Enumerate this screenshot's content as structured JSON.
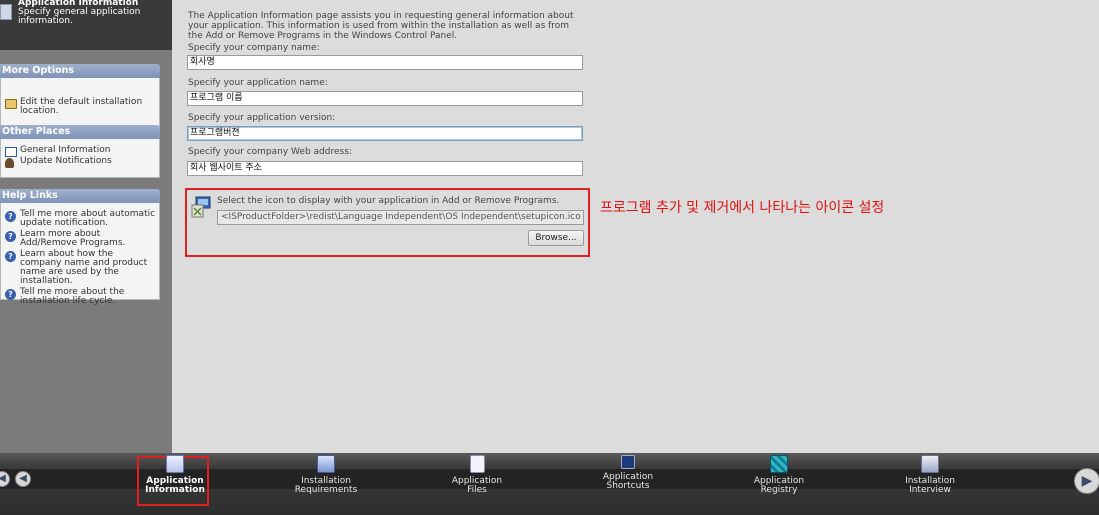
{
  "sidebar": {
    "header": {
      "title": "Application Information",
      "description": "Specify general application information."
    },
    "more_options": {
      "title": "More Options",
      "items": [
        {
          "label": "Edit the default installation location.",
          "icon": "folder-icon"
        }
      ]
    },
    "other_places": {
      "title": "Other Places",
      "items": [
        {
          "label": "General Information",
          "icon": "info-window-icon"
        },
        {
          "label": "Update Notifications",
          "icon": "person-icon"
        }
      ]
    },
    "help_links": {
      "title": "Help Links",
      "items": [
        {
          "label": "Tell me more about automatic update notification.",
          "icon": "help-icon"
        },
        {
          "label": "Learn more about Add/Remove Programs.",
          "icon": "help-icon"
        },
        {
          "label": "Learn about how the company name and product name are used by the installation.",
          "icon": "help-icon"
        },
        {
          "label": "Tell me more about the installation life cycle.",
          "icon": "help-icon"
        }
      ]
    }
  },
  "main": {
    "intro": "The Application Information page assists you in requesting general information about your application. This information is used from within the installation as well as from the Add or Remove Programs in the Windows Control Panel.",
    "fields": {
      "company_name": {
        "label": "Specify your company name:",
        "value": "회사명"
      },
      "app_name": {
        "label": "Specify your application name:",
        "value": "프로그램 이름"
      },
      "app_version": {
        "label": "Specify your application version:",
        "value": "프로그램버젼"
      },
      "web_address": {
        "label": "Specify your company Web address:",
        "value": "회사 웹사이트 주소"
      }
    },
    "icon_section": {
      "label": "Select the icon to display with your application in Add or Remove Programs.",
      "path": "<ISProductFolder>\\redist\\Language Independent\\OS Independent\\setupicon.ico",
      "browse_label": "Browse..."
    },
    "annotation": "프로그램 추가 및 제거에서 나타나는 아이콘 설정"
  },
  "bottom_bar": {
    "prev_symbol": "◀",
    "next_symbol": "▶",
    "tabs": [
      {
        "label_1": "Application",
        "label_2": "Information",
        "icon": "application-information-icon",
        "active": true
      },
      {
        "label_1": "Installation",
        "label_2": "Requirements",
        "icon": "installation-requirements-icon",
        "active": false
      },
      {
        "label_1": "Application",
        "label_2": "Files",
        "icon": "application-files-icon",
        "active": false
      },
      {
        "label_1": "Application",
        "label_2": "Shortcuts",
        "icon": "application-shortcuts-icon",
        "active": false
      },
      {
        "label_1": "Application",
        "label_2": "Registry",
        "icon": "application-registry-icon",
        "active": false
      },
      {
        "label_1": "Installation",
        "label_2": "Interview",
        "icon": "installation-interview-icon",
        "active": false
      }
    ]
  },
  "colors": {
    "highlight_red": "#e02020",
    "panel_title": "#8a9dc0"
  }
}
